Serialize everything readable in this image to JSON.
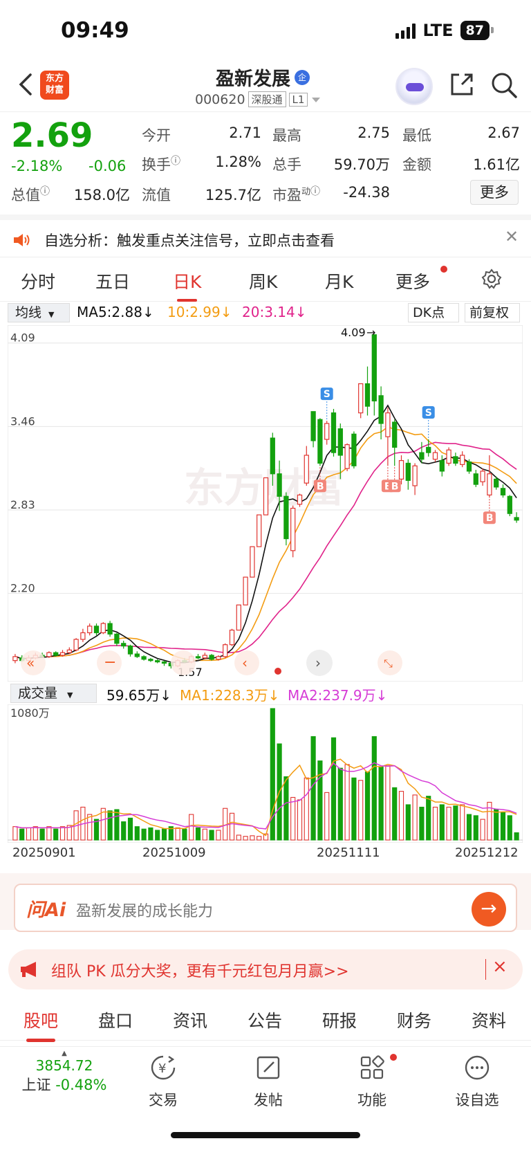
{
  "status": {
    "time": "09:49",
    "network": "LTE",
    "battery": "87"
  },
  "header": {
    "title": "盈新发展",
    "title_badge": "企",
    "code": "000620",
    "tags": [
      "深股通",
      "L1"
    ],
    "logo_text": "东方财富"
  },
  "quote": {
    "price": "2.69",
    "change_pct": "-2.18%",
    "change": "-0.06",
    "open_label": "今开",
    "open": "2.71",
    "high_label": "最高",
    "high": "2.75",
    "low_label": "最低",
    "low": "2.67",
    "turnover_label": "换手",
    "turnover": "1.28%",
    "volume_label": "总手",
    "volume": "59.70万",
    "amount_label": "金额",
    "amount": "1.61亿",
    "mktcap_label": "总值",
    "mktcap": "158.0亿",
    "float_label": "流值",
    "float": "125.7亿",
    "pe_label": "市盈",
    "pe_sup": "动",
    "pe": "-24.38",
    "more_label": "更多"
  },
  "banner": {
    "text": "自选分析：触发重点关注信号，立即点击查看"
  },
  "chart_tabs": [
    "分时",
    "五日",
    "日K",
    "周K",
    "月K",
    "更多"
  ],
  "active_chart_tab": "日K",
  "ma_row": {
    "selector": "均线",
    "ma5": "MA5:2.88",
    "ma10": "10:2.99",
    "ma20": "20:3.14",
    "dk_button": "DK点",
    "fq_button": "前复权"
  },
  "vol_row": {
    "selector": "成交量",
    "vol": "59.65万",
    "ma1": "MA1:228.3万",
    "ma2": "MA2:237.9万"
  },
  "colors": {
    "up": "#e0342f",
    "down": "#13a10e",
    "ma5": "#111111",
    "ma10": "#f39c12",
    "ma20": "#e0228a",
    "vma1": "#f39c12",
    "vma2": "#d63cd6"
  },
  "chart_data": {
    "type": "candlestick",
    "y_ticks": [
      "4.09",
      "3.46",
      "2.83",
      "2.20"
    ],
    "ylim": [
      1.55,
      4.12
    ],
    "max_annotation": "4.09",
    "min_annotation": "1.57",
    "x_labels": [
      "20250901",
      "20251009",
      "20251111",
      "20251212"
    ],
    "vol_max_label": "1080万",
    "signals": [
      {
        "label": "S",
        "index": 46
      },
      {
        "label": "S",
        "index": 61
      },
      {
        "label": "B",
        "index": 45
      },
      {
        "label": "B",
        "index": 55
      },
      {
        "label": "B",
        "index": 56
      },
      {
        "label": "B",
        "index": 70
      }
    ],
    "candles": [
      {
        "o": 1.63,
        "c": 1.66,
        "h": 1.68,
        "l": 1.61,
        "v": 110
      },
      {
        "o": 1.65,
        "c": 1.63,
        "h": 1.67,
        "l": 1.62,
        "v": 90
      },
      {
        "o": 1.63,
        "c": 1.65,
        "h": 1.67,
        "l": 1.62,
        "v": 100
      },
      {
        "o": 1.65,
        "c": 1.67,
        "h": 1.69,
        "l": 1.64,
        "v": 110
      },
      {
        "o": 1.67,
        "c": 1.66,
        "h": 1.69,
        "l": 1.65,
        "v": 90
      },
      {
        "o": 1.66,
        "c": 1.69,
        "h": 1.7,
        "l": 1.65,
        "v": 110
      },
      {
        "o": 1.69,
        "c": 1.67,
        "h": 1.7,
        "l": 1.66,
        "v": 90
      },
      {
        "o": 1.67,
        "c": 1.69,
        "h": 1.71,
        "l": 1.66,
        "v": 110
      },
      {
        "o": 1.69,
        "c": 1.71,
        "h": 1.73,
        "l": 1.68,
        "v": 120
      },
      {
        "o": 1.71,
        "c": 1.79,
        "h": 1.8,
        "l": 1.7,
        "v": 240
      },
      {
        "o": 1.79,
        "c": 1.84,
        "h": 1.87,
        "l": 1.77,
        "v": 270
      },
      {
        "o": 1.84,
        "c": 1.89,
        "h": 1.91,
        "l": 1.82,
        "v": 210
      },
      {
        "o": 1.89,
        "c": 1.84,
        "h": 1.91,
        "l": 1.82,
        "v": 170
      },
      {
        "o": 1.84,
        "c": 1.91,
        "h": 1.92,
        "l": 1.83,
        "v": 260
      },
      {
        "o": 1.91,
        "c": 1.83,
        "h": 1.93,
        "l": 1.81,
        "v": 240
      },
      {
        "o": 1.83,
        "c": 1.76,
        "h": 1.84,
        "l": 1.74,
        "v": 250
      },
      {
        "o": 1.76,
        "c": 1.74,
        "h": 1.78,
        "l": 1.72,
        "v": 150
      },
      {
        "o": 1.74,
        "c": 1.68,
        "h": 1.75,
        "l": 1.66,
        "v": 180
      },
      {
        "o": 1.68,
        "c": 1.66,
        "h": 1.7,
        "l": 1.65,
        "v": 110
      },
      {
        "o": 1.66,
        "c": 1.64,
        "h": 1.67,
        "l": 1.63,
        "v": 90
      },
      {
        "o": 1.64,
        "c": 1.63,
        "h": 1.65,
        "l": 1.62,
        "v": 100
      },
      {
        "o": 1.63,
        "c": 1.62,
        "h": 1.64,
        "l": 1.61,
        "v": 80
      },
      {
        "o": 1.62,
        "c": 1.61,
        "h": 1.63,
        "l": 1.59,
        "v": 90
      },
      {
        "o": 1.61,
        "c": 1.59,
        "h": 1.62,
        "l": 1.57,
        "v": 110
      },
      {
        "o": 1.59,
        "c": 1.63,
        "h": 1.64,
        "l": 1.58,
        "v": 100
      },
      {
        "o": 1.63,
        "c": 1.62,
        "h": 1.65,
        "l": 1.61,
        "v": 90
      },
      {
        "o": 1.62,
        "c": 1.66,
        "h": 1.67,
        "l": 1.61,
        "v": 210
      },
      {
        "o": 1.66,
        "c": 1.65,
        "h": 1.68,
        "l": 1.64,
        "v": 100
      },
      {
        "o": 1.65,
        "c": 1.67,
        "h": 1.69,
        "l": 1.64,
        "v": 90
      },
      {
        "o": 1.67,
        "c": 1.64,
        "h": 1.68,
        "l": 1.63,
        "v": 80
      },
      {
        "o": 1.64,
        "c": 1.66,
        "h": 1.67,
        "l": 1.63,
        "v": 80
      },
      {
        "o": 1.66,
        "c": 1.75,
        "h": 1.76,
        "l": 1.65,
        "v": 260
      },
      {
        "o": 1.75,
        "c": 1.86,
        "h": 1.87,
        "l": 1.74,
        "v": 220
      },
      {
        "o": 1.86,
        "c": 2.05,
        "h": 2.05,
        "l": 1.86,
        "v": 40
      },
      {
        "o": 2.05,
        "c": 2.26,
        "h": 2.26,
        "l": 2.05,
        "v": 30
      },
      {
        "o": 2.26,
        "c": 2.49,
        "h": 2.49,
        "l": 2.26,
        "v": 35
      },
      {
        "o": 2.49,
        "c": 2.73,
        "h": 2.73,
        "l": 2.49,
        "v": 30
      },
      {
        "o": 2.73,
        "c": 3.01,
        "h": 3.01,
        "l": 2.73,
        "v": 50
      },
      {
        "o": 3.31,
        "c": 3.04,
        "h": 3.35,
        "l": 2.95,
        "v": 1080
      },
      {
        "o": 3.04,
        "c": 2.87,
        "h": 3.14,
        "l": 2.76,
        "v": 790
      },
      {
        "o": 2.87,
        "c": 2.55,
        "h": 2.9,
        "l": 2.5,
        "v": 520
      },
      {
        "o": 2.46,
        "c": 2.78,
        "h": 2.8,
        "l": 2.41,
        "v": 350
      },
      {
        "o": 2.81,
        "c": 2.88,
        "h": 2.89,
        "l": 2.79,
        "v": 330
      },
      {
        "o": 2.97,
        "c": 3.18,
        "h": 3.25,
        "l": 2.95,
        "v": 510
      },
      {
        "o": 3.51,
        "c": 3.29,
        "h": 3.51,
        "l": 3.24,
        "v": 850
      },
      {
        "o": 3.45,
        "c": 3.12,
        "h": 3.46,
        "l": 3.1,
        "v": 650
      },
      {
        "o": 3.3,
        "c": 3.42,
        "h": 3.44,
        "l": 3.26,
        "v": 390
      },
      {
        "o": 3.5,
        "c": 3.2,
        "h": 3.53,
        "l": 3.17,
        "v": 840
      },
      {
        "o": 3.38,
        "c": 3.18,
        "h": 3.42,
        "l": 3.0,
        "v": 590
      },
      {
        "o": 3.08,
        "c": 3.26,
        "h": 3.27,
        "l": 3.06,
        "v": 620
      },
      {
        "o": 3.34,
        "c": 3.1,
        "h": 3.36,
        "l": 3.08,
        "v": 510
      },
      {
        "o": 3.5,
        "c": 3.72,
        "h": 3.72,
        "l": 3.46,
        "v": 490
      },
      {
        "o": 3.72,
        "c": 3.55,
        "h": 3.85,
        "l": 3.48,
        "v": 560
      },
      {
        "o": 4.09,
        "c": 3.59,
        "h": 4.09,
        "l": 3.48,
        "v": 850
      },
      {
        "o": 3.63,
        "c": 3.42,
        "h": 3.7,
        "l": 3.3,
        "v": 600
      },
      {
        "o": 3.32,
        "c": 3.5,
        "h": 3.54,
        "l": 3.1,
        "v": 610
      },
      {
        "o": 3.43,
        "c": 3.24,
        "h": 3.45,
        "l": 3.1,
        "v": 430
      },
      {
        "o": 3.0,
        "c": 3.14,
        "h": 3.18,
        "l": 2.96,
        "v": 400
      },
      {
        "o": 3.12,
        "c": 2.99,
        "h": 3.15,
        "l": 2.92,
        "v": 290
      },
      {
        "o": 2.95,
        "c": 3.1,
        "h": 3.12,
        "l": 2.88,
        "v": 370
      },
      {
        "o": 3.2,
        "c": 3.15,
        "h": 3.28,
        "l": 3.12,
        "v": 270
      },
      {
        "o": 3.24,
        "c": 3.2,
        "h": 3.3,
        "l": 3.17,
        "v": 360
      },
      {
        "o": 3.15,
        "c": 3.2,
        "h": 3.22,
        "l": 3.13,
        "v": 270
      },
      {
        "o": 3.14,
        "c": 3.06,
        "h": 3.18,
        "l": 3.02,
        "v": 290
      },
      {
        "o": 3.12,
        "c": 3.22,
        "h": 3.24,
        "l": 3.1,
        "v": 270
      },
      {
        "o": 3.17,
        "c": 3.12,
        "h": 3.2,
        "l": 3.1,
        "v": 280
      },
      {
        "o": 3.11,
        "c": 3.18,
        "h": 3.21,
        "l": 3.09,
        "v": 290
      },
      {
        "o": 3.13,
        "c": 3.06,
        "h": 3.15,
        "l": 3.04,
        "v": 210
      },
      {
        "o": 3.04,
        "c": 2.96,
        "h": 3.07,
        "l": 2.94,
        "v": 200
      },
      {
        "o": 2.98,
        "c": 3.06,
        "h": 3.08,
        "l": 2.95,
        "v": 170
      },
      {
        "o": 2.88,
        "c": 3.04,
        "h": 3.18,
        "l": 2.86,
        "v": 310
      },
      {
        "o": 3.0,
        "c": 2.94,
        "h": 3.02,
        "l": 2.92,
        "v": 250
      },
      {
        "o": 2.93,
        "c": 2.88,
        "h": 2.96,
        "l": 2.86,
        "v": 230
      },
      {
        "o": 2.87,
        "c": 2.74,
        "h": 2.88,
        "l": 2.72,
        "v": 200
      },
      {
        "o": 2.71,
        "c": 2.69,
        "h": 2.75,
        "l": 2.67,
        "v": 60
      }
    ]
  },
  "ask": {
    "logo": "问Ai",
    "placeholder": "盈新发展的成长能力",
    "go": "→"
  },
  "promo": {
    "text": "组队 PK 瓜分大奖，更有千元红包月月赢>>",
    "close": "×"
  },
  "sub_tabs": [
    "股吧",
    "盘口",
    "资讯",
    "公告",
    "研报",
    "财务",
    "资料"
  ],
  "active_sub_tab": "股吧",
  "bottom_bar": {
    "index_value": "3854.72",
    "index_name": "上证",
    "index_change": "-0.48%",
    "items": [
      "交易",
      "发帖",
      "功能",
      "设自选"
    ]
  }
}
